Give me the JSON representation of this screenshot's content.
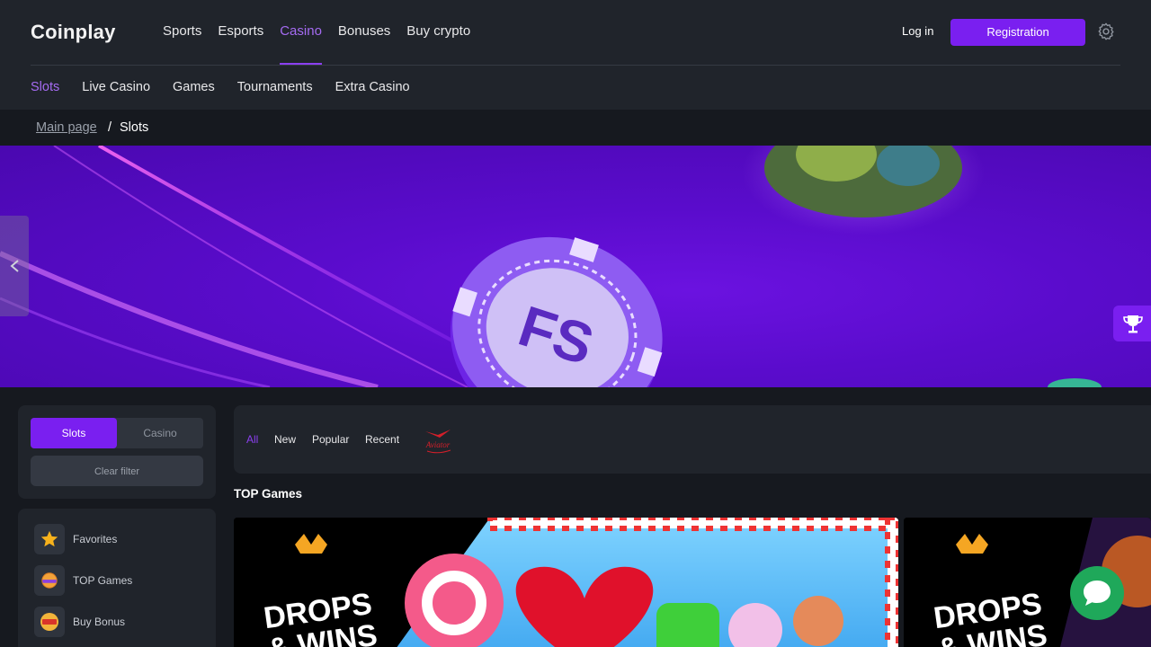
{
  "header": {
    "logo": "Coinplay",
    "nav": [
      "Sports",
      "Esports",
      "Casino",
      "Bonuses",
      "Buy crypto"
    ],
    "nav_active": "Casino",
    "login_label": "Log in",
    "register_label": "Registration",
    "sub_nav": [
      "Slots",
      "Live Casino",
      "Games",
      "Tournaments",
      "Extra Casino"
    ],
    "sub_nav_active": "Slots"
  },
  "breadcrumb": {
    "home": "Main page",
    "separator": "/",
    "current": "Slots"
  },
  "banner": {
    "chip_text": "FS"
  },
  "sidebar": {
    "segment": [
      "Slots",
      "Casino"
    ],
    "segment_active": "Slots",
    "clear_filter": "Clear filter",
    "items": [
      {
        "label": "Favorites",
        "icon": "star-icon"
      },
      {
        "label": "TOP Games",
        "icon": "top-games-icon"
      },
      {
        "label": "Buy Bonus",
        "icon": "bonus-icon"
      }
    ]
  },
  "filters": {
    "tabs": [
      "All",
      "New",
      "Popular",
      "Recent"
    ],
    "active": "All",
    "provider_logo_text": "Aviator"
  },
  "section_title": "TOP Games",
  "cards": [
    {
      "badge_line1": "DROPS",
      "badge_line2": "& WINS"
    },
    {
      "badge_line1": "DROPS",
      "badge_line2": "& WINS"
    }
  ],
  "colors": {
    "accent": "#7a1ff0",
    "accent_text": "#a56bf2",
    "header_bg": "#20242b",
    "page_bg": "#16191f",
    "chat": "#1fa85a"
  }
}
